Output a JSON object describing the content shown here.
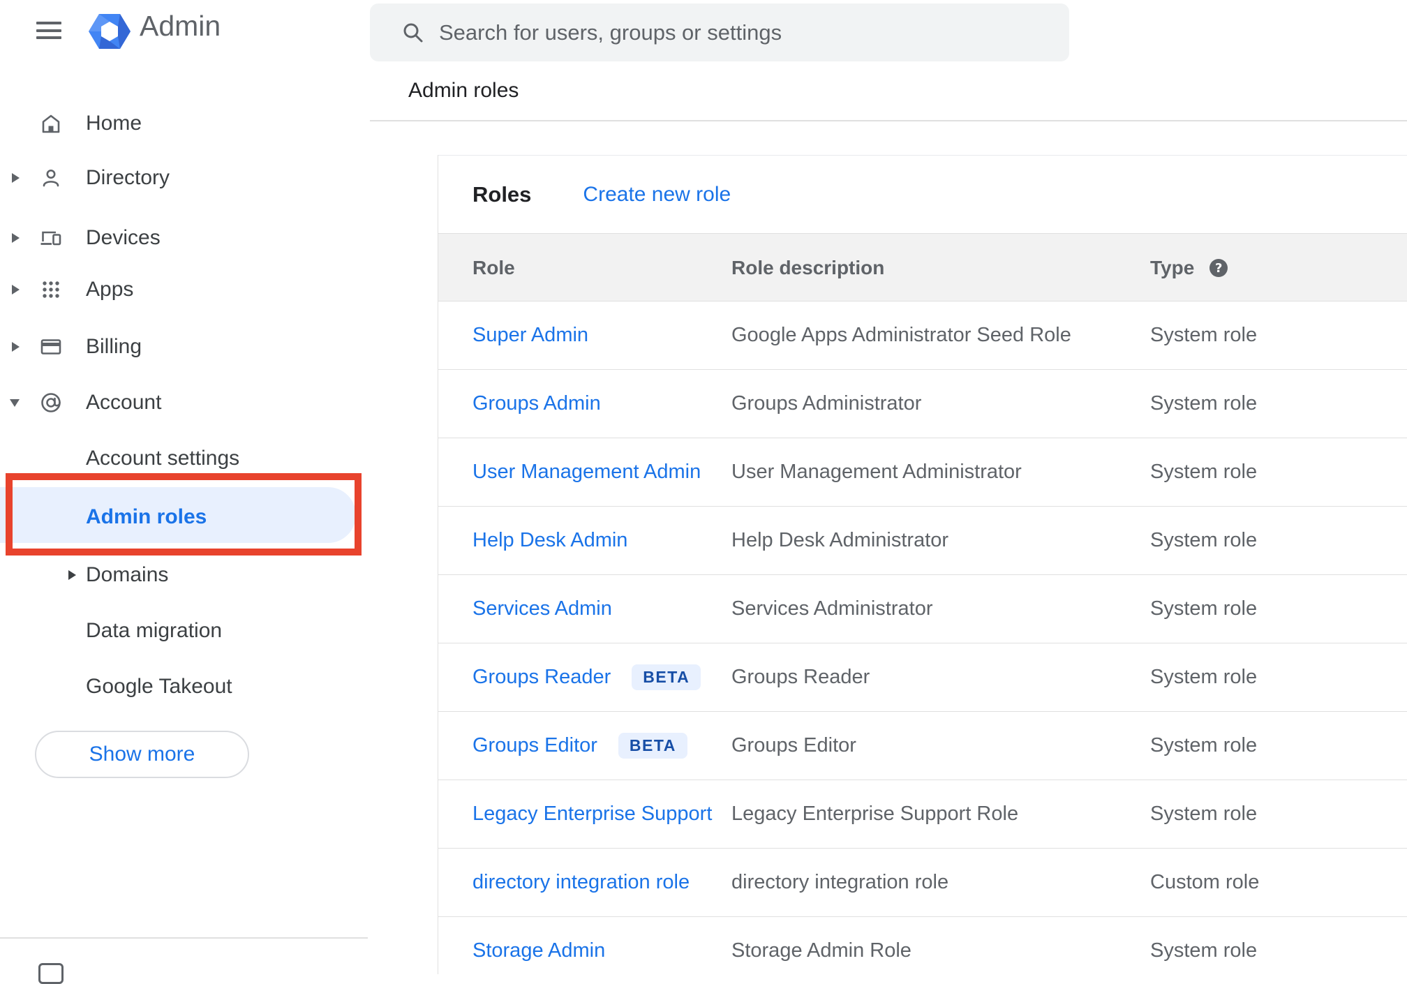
{
  "app": {
    "title": "Admin"
  },
  "search": {
    "placeholder": "Search for users, groups or settings"
  },
  "breadcrumb": "Admin roles",
  "sidebar": {
    "items": [
      {
        "label": "Home",
        "icon": "home-icon",
        "arrow": "none",
        "kind": "top"
      },
      {
        "label": "Directory",
        "icon": "person-icon",
        "arrow": "right",
        "kind": "top"
      },
      {
        "label": "Devices",
        "icon": "devices-icon",
        "arrow": "right",
        "kind": "top"
      },
      {
        "label": "Apps",
        "icon": "apps-grid-icon",
        "arrow": "right",
        "kind": "top"
      },
      {
        "label": "Billing",
        "icon": "card-icon",
        "arrow": "right",
        "kind": "top"
      },
      {
        "label": "Account",
        "icon": "at-sign-icon",
        "arrow": "down",
        "kind": "top"
      },
      {
        "label": "Account settings",
        "arrow": "none",
        "kind": "sub"
      },
      {
        "label": "Admin roles",
        "arrow": "none",
        "kind": "sub",
        "selected": true
      },
      {
        "label": "Domains",
        "arrow": "right",
        "kind": "sub"
      },
      {
        "label": "Data migration",
        "arrow": "none",
        "kind": "sub"
      },
      {
        "label": "Google Takeout",
        "arrow": "none",
        "kind": "sub"
      }
    ],
    "show_more_label": "Show more"
  },
  "roles_panel": {
    "heading": "Roles",
    "create_link": "Create new role",
    "columns": {
      "role": "Role",
      "description": "Role description",
      "type": "Type"
    },
    "rows": [
      {
        "role": "Super Admin",
        "beta": false,
        "description": "Google Apps Administrator Seed Role",
        "type": "System role"
      },
      {
        "role": "Groups Admin",
        "beta": false,
        "description": "Groups Administrator",
        "type": "System role"
      },
      {
        "role": "User Management Admin",
        "beta": false,
        "description": "User Management Administrator",
        "type": "System role"
      },
      {
        "role": "Help Desk Admin",
        "beta": false,
        "description": "Help Desk Administrator",
        "type": "System role"
      },
      {
        "role": "Services Admin",
        "beta": false,
        "description": "Services Administrator",
        "type": "System role"
      },
      {
        "role": "Groups Reader",
        "beta": true,
        "beta_label": "BETA",
        "description": "Groups Reader",
        "type": "System role"
      },
      {
        "role": "Groups Editor",
        "beta": true,
        "beta_label": "BETA",
        "description": "Groups Editor",
        "type": "System role"
      },
      {
        "role": "Legacy Enterprise Support",
        "beta": false,
        "description": "Legacy Enterprise Support Role",
        "type": "System role"
      },
      {
        "role": "directory integration role",
        "beta": false,
        "description": "directory integration role",
        "type": "Custom role"
      },
      {
        "role": "Storage Admin",
        "beta": false,
        "description": "Storage Admin Role",
        "type": "System role"
      }
    ]
  },
  "colors": {
    "link_blue": "#1a73e8",
    "selected_bg": "#e8f0fe",
    "annotation_red": "#e8432d",
    "badge_bg": "#e8f0fe",
    "badge_text": "#174ea6",
    "gray_text": "#5f6368",
    "dark_text": "#202124"
  }
}
